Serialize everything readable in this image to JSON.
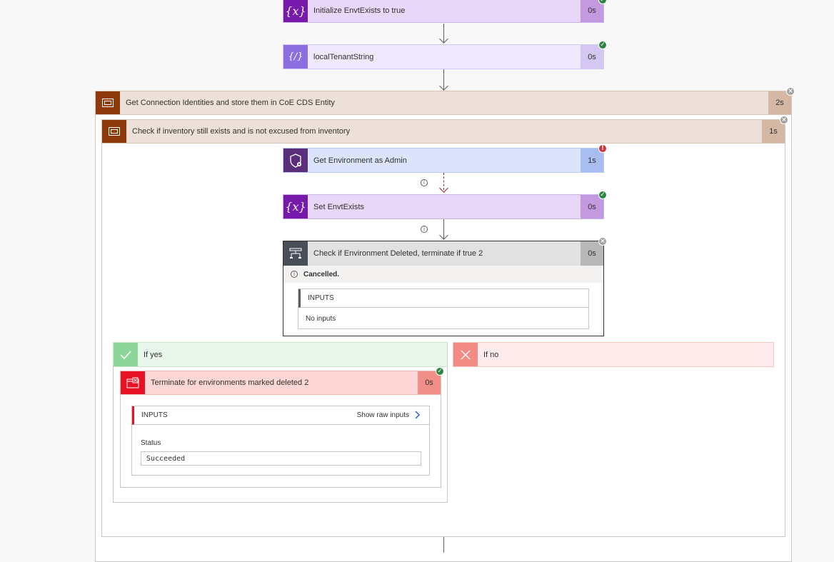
{
  "colors": {
    "variable": "#7719aa",
    "variable_light": "#e8d7f8",
    "compose_light": "#efe9fd",
    "scope": "#8f3a0c",
    "scope_light": "#ede0d8",
    "admin": "#5a2e7a",
    "admin_light": "#dbe4fb",
    "condition": "#484f58",
    "yes": "#8ed59a",
    "no": "#f18b84",
    "terminate": "#e81123"
  },
  "steps": {
    "init_envt": {
      "title": "Initialize EnvtExists to true",
      "duration": "0s",
      "icon": "variable-icon",
      "status": "succeeded"
    },
    "local_tenant": {
      "title": "localTenantString",
      "duration": "0s",
      "icon": "compose-icon",
      "status": "succeeded"
    },
    "scope_outer": {
      "title": "Get Connection Identities and store them in CoE CDS Entity",
      "duration": "2s",
      "icon": "scope-icon",
      "status": "cancelled"
    },
    "scope_inner": {
      "title": "Check if inventory still exists and is not excused from inventory",
      "duration": "1s",
      "icon": "scope-icon",
      "status": "cancelled"
    },
    "get_env_admin": {
      "title": "Get Environment as Admin",
      "duration": "1s",
      "icon": "admin-shield-icon",
      "status": "failed"
    },
    "set_envt": {
      "title": "Set EnvtExists",
      "duration": "0s",
      "icon": "variable-icon",
      "status": "succeeded"
    },
    "condition": {
      "title": "Check if Environment Deleted, terminate if true 2",
      "duration": "0s",
      "icon": "condition-icon",
      "status": "cancelled",
      "status_text": "Cancelled.",
      "inputs_label": "INPUTS",
      "inputs_value": "No inputs"
    },
    "if_yes": {
      "label": "If yes",
      "icon": "check-icon"
    },
    "if_no": {
      "label": "If no",
      "icon": "close-icon"
    },
    "terminate": {
      "title": "Terminate for environments marked deleted 2",
      "duration": "0s",
      "icon": "terminate-icon",
      "status": "succeeded",
      "inputs_label": "INPUTS",
      "show_raw": "Show raw inputs",
      "status_label": "Status",
      "status_value": "Succeeded"
    }
  }
}
